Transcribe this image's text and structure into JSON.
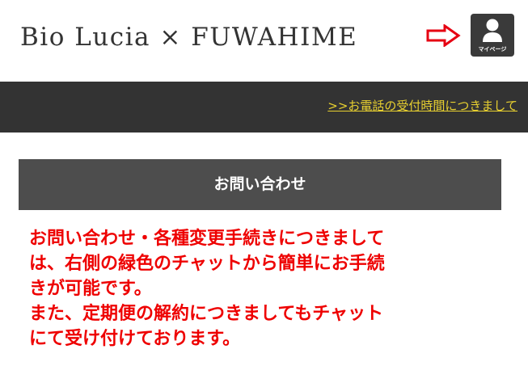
{
  "header": {
    "brand": "Bio Lucia × FUWAHIME",
    "mypage_label": "マイページ"
  },
  "topbar": {
    "phone_link": ">>お電話の受付時間につきまして"
  },
  "section": {
    "title": "お問い合わせ"
  },
  "notice": {
    "lines": [
      "お問い合わせ・各種変更手続きにつきまして",
      "は、右側の緑色のチャットから簡単にお手続",
      "きが可能です。",
      "また、定期便の解約につきましてもチャット",
      "にて受け付けております。"
    ]
  },
  "colors": {
    "accent_red": "#ee0000",
    "link_yellow": "#e8d030",
    "dark_bar": "#333333",
    "title_bar": "#4d4d4d"
  },
  "icons": {
    "arrow": "right-arrow-outline-icon",
    "mypage": "user-icon"
  }
}
